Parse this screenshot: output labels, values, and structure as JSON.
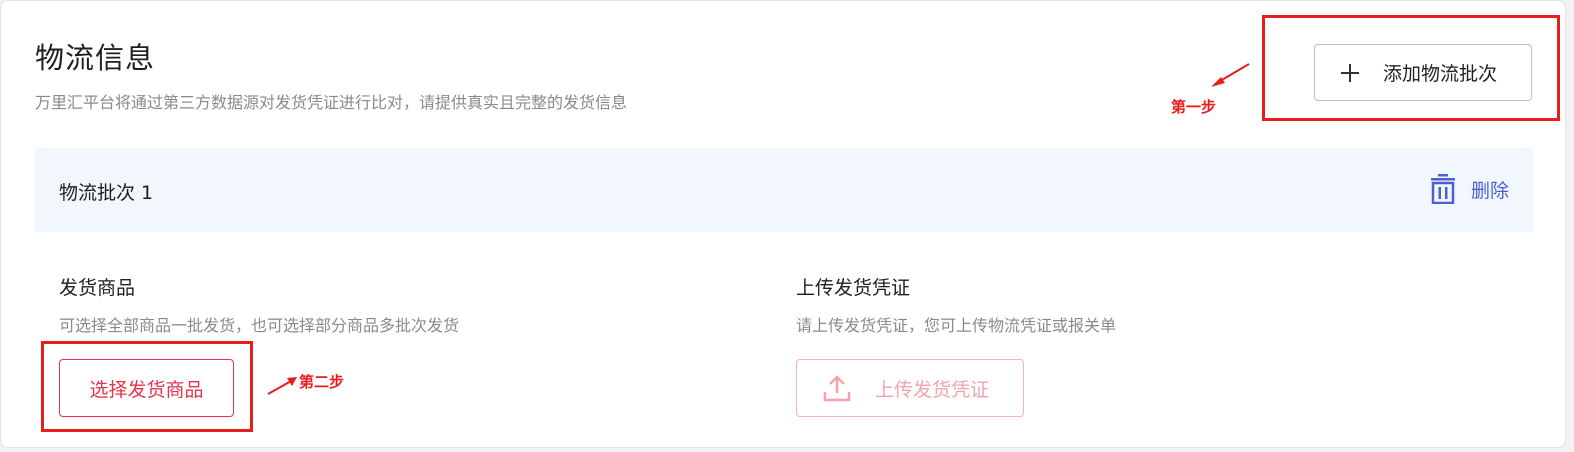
{
  "header": {
    "title": "物流信息",
    "subtitle": "万里汇平台将通过第三方数据源对发货凭证进行比对，请提供真实且完整的发货信息",
    "add_batch_label": "添加物流批次"
  },
  "batch": {
    "title": "物流批次 1",
    "delete_label": "删除"
  },
  "goods_section": {
    "title": "发货商品",
    "description": "可选择全部商品一批发货，也可选择部分商品多批次发货",
    "button_label": "选择发货商品"
  },
  "upload_section": {
    "title": "上传发货凭证",
    "description": "请上传发货凭证，您可上传物流凭证或报关单",
    "button_label": "上传发货凭证"
  },
  "annotations": {
    "step1": "第一步",
    "step2": "第二步"
  },
  "icons": {
    "add": "plus-icon",
    "delete": "trash-icon",
    "upload": "upload-icon"
  },
  "colors": {
    "primary_red": "#e8334a",
    "disabled_red": "#f2a3ae",
    "link_blue": "#4a5fd6",
    "annotation_red": "#e81e1e",
    "batch_header_bg": "#f2f6fd"
  }
}
